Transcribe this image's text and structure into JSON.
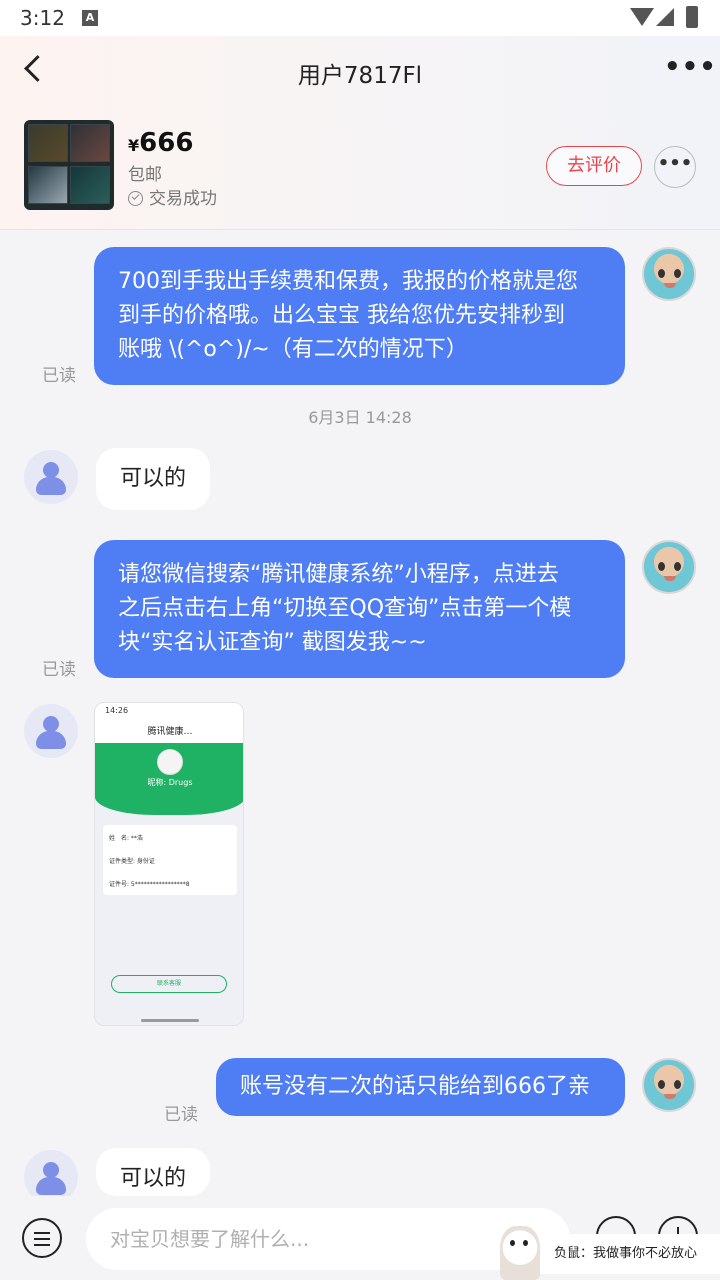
{
  "status_bar": {
    "time": "3:12",
    "notification_icon": "A"
  },
  "header": {
    "title": "用户7817Fl",
    "more_label": "•••"
  },
  "product": {
    "currency": "¥",
    "price": "666",
    "shipping": "包邮",
    "status": "交易成功",
    "review_button": "去评价",
    "more_label": "•••"
  },
  "messages": [
    {
      "side": "right",
      "text_lines": [
        "700到手我出手续费和保费，我报的价格就是您",
        "到手的价格哦。出么宝宝 我给您优先安排秒到",
        "账哦 \\(^o^)/~（有二次的情况下）"
      ],
      "read": "已读"
    },
    {
      "side": "left",
      "text": "可以的"
    },
    {
      "side": "right",
      "text_lines": [
        "请您微信搜索“腾讯健康系统”小程序，点进去",
        "之后点击右上角“切换至QQ查询”点击第一个模",
        "块“实名认证查询” 截图发我~~"
      ],
      "read": "已读"
    },
    {
      "side": "right",
      "text": "账号没有二次的话只能给到666了亲",
      "read": "已读"
    },
    {
      "side": "left",
      "text": "可以的"
    }
  ],
  "timestamp": "6月3日 14:28",
  "screenshot_image": {
    "status_time": "14:26",
    "nav_title": "腾讯健康…",
    "nickname": "昵称: Drugs",
    "rows": [
      "姓　名: **浩",
      "证件类型: 身份证",
      "证件号: 5*****************8"
    ],
    "button": "联系客服"
  },
  "input": {
    "placeholder": "对宝贝想要了解什么..."
  },
  "watermark": "负鼠：我做事你不必放心",
  "colors": {
    "accent_blue": "#4f7df3",
    "review_red": "#e6464b",
    "green": "#1fb264"
  }
}
